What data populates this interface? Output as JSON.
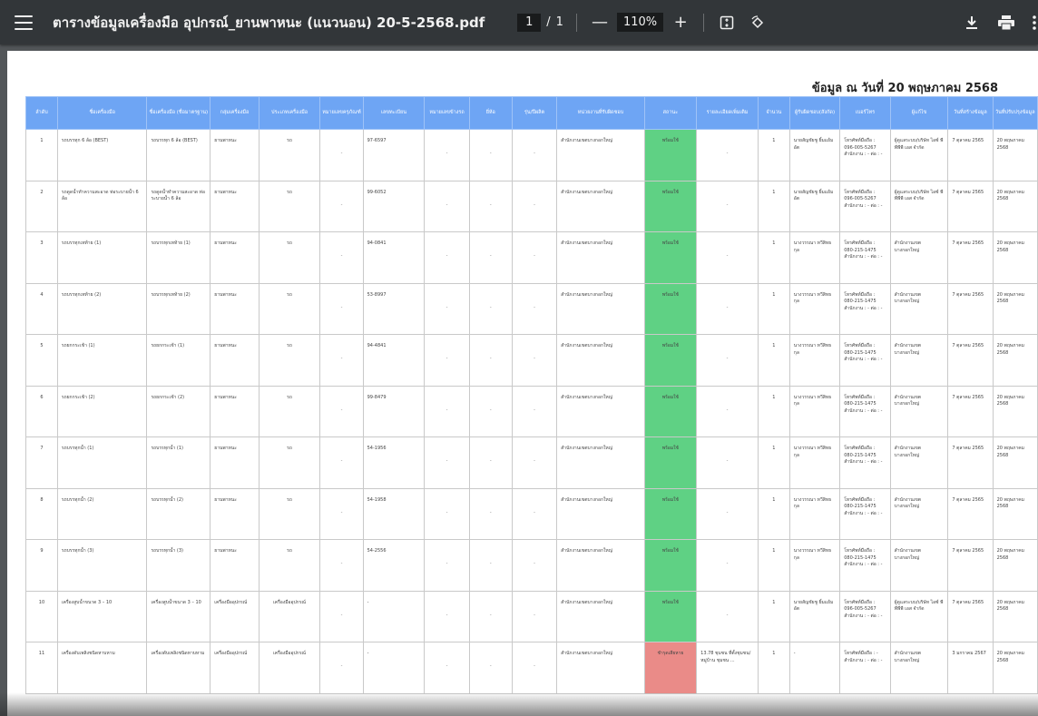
{
  "toolbar": {
    "title": "ตารางข้อมูลเครื่องมือ อุปกรณ์_ยานพาหนะ (แนวนอน) 20-5-2568.pdf",
    "page_current": "1",
    "page_sep": "/",
    "page_total": "1",
    "zoom": "110%",
    "zoom_out": "—",
    "zoom_in": "+"
  },
  "document": {
    "date_heading": "ข้อมูล ณ วันที่ 20 พฤษภาคม 2568",
    "headers": [
      "ลำดับ",
      "ชื่อเครื่องมือ",
      "ชื่อเครื่องมือ (ชื่อมาตรฐาน)",
      "กลุ่มเครื่องมือ",
      "ประเภทเครื่องมือ",
      "หมายเลขครุภัณฑ์",
      "เลขทะเบียน",
      "หมายเลขข้างรถ",
      "ยี่ห้อ",
      "รุ่น/ปีผลิต",
      "หน่วยงานที่รับผิดชอบ",
      "สถานะ",
      "รายละเอียดเพิ่มเติม",
      "จำนวน",
      "ผู้รับผิดชอบ(สังกัด)",
      "เบอร์โทร",
      "ผู้แก้ไข",
      "วันที่สร้างข้อมูล",
      "วันที่ปรับปรุงข้อมูล"
    ],
    "rows": [
      {
        "no": "1",
        "name": "รถบรรทุก 6 ล้อ (BEST)",
        "std_name": "รถบรรทุก 6 ล้อ (BEST)",
        "group": "ยานพาหนะ",
        "type": "รถ",
        "asset": "-",
        "reg": "97-6597",
        "side": "-",
        "brand": "-",
        "model": "-",
        "agency": "สำนักงานเขตบางกอกใหญ่",
        "status": "พร้อมใช้",
        "status_ok": true,
        "detail": "-",
        "qty": "1",
        "owner": "นายสัญชัยชู ยิ้มแย้มอัต",
        "phone": "โทรศัพท์มือถือ : 096-005-5267 สำนักงาน : - ต่อ : -",
        "editor": "ผู้ดูแลระบบ/บริษัท ไอซ์ พีพีพีพี เอส จำกัด",
        "created": "7 ตุลาคม 2565",
        "updated": "20 พฤษภาคม 2568"
      },
      {
        "no": "2",
        "name": "รถดูดน้ำทำความสะอาด ท่อระบายน้ำ 6 ล้อ",
        "std_name": "รถดูดน้ำทำความสะอาด ท่อระบายน้ำ 6 ล้อ",
        "group": "ยานพาหนะ",
        "type": "รถ",
        "asset": "-",
        "reg": "99-6052",
        "side": "-",
        "brand": "-",
        "model": "-",
        "agency": "สำนักงานเขตบางกอกใหญ่",
        "status": "พร้อมใช้",
        "status_ok": true,
        "detail": "-",
        "qty": "1",
        "owner": "นายสัญชัยชู ยิ้มแย้มอัต",
        "phone": "โทรศัพท์มือถือ : 096-005-5267 สำนักงาน : - ต่อ : -",
        "editor": "ผู้ดูแลระบบ/บริษัท ไอซ์ พีพีพีพี เอส จำกัด",
        "created": "7 ตุลาคม 2565",
        "updated": "20 พฤษภาคม 2568"
      },
      {
        "no": "3",
        "name": "รถบรรทุกเทท้าย (1)",
        "std_name": "รถบรรทุกเทท้าย (1)",
        "group": "ยานพาหนะ",
        "type": "รถ",
        "asset": "-",
        "reg": "94-0841",
        "side": "-",
        "brand": "-",
        "model": "-",
        "agency": "สำนักงานเขตบางกอกใหญ่",
        "status": "พร้อมใช้",
        "status_ok": true,
        "detail": "-",
        "qty": "1",
        "owner": "นางวรรณา ทวีสิทธกุล",
        "phone": "โทรศัพท์มือถือ : 080-215-1475 สำนักงาน : - ต่อ : -",
        "editor": "สำนักงานเขตบางกอกใหญ่",
        "created": "7 ตุลาคม 2565",
        "updated": "20 พฤษภาคม 2568"
      },
      {
        "no": "4",
        "name": "รถบรรทุกเทท้าย (2)",
        "std_name": "รถบรรทุกเทท้าย (2)",
        "group": "ยานพาหนะ",
        "type": "รถ",
        "asset": "-",
        "reg": "53-8997",
        "side": "-",
        "brand": "-",
        "model": "-",
        "agency": "สำนักงานเขตบางกอกใหญ่",
        "status": "พร้อมใช้",
        "status_ok": true,
        "detail": "-",
        "qty": "1",
        "owner": "นางวรรณา ทวีสิทธกุล",
        "phone": "โทรศัพท์มือถือ : 080-215-1475 สำนักงาน : - ต่อ : -",
        "editor": "สำนักงานเขตบางกอกใหญ่",
        "created": "7 ตุลาคม 2565",
        "updated": "20 พฤษภาคม 2568"
      },
      {
        "no": "5",
        "name": "รถยกกระเช้า (1)",
        "std_name": "รถยกกระเช้า (1)",
        "group": "ยานพาหนะ",
        "type": "รถ",
        "asset": "-",
        "reg": "94-4841",
        "side": "-",
        "brand": "-",
        "model": "-",
        "agency": "สำนักงานเขตบางกอกใหญ่",
        "status": "พร้อมใช้",
        "status_ok": true,
        "detail": "-",
        "qty": "1",
        "owner": "นางวรรณา ทวีสิทธกุล",
        "phone": "โทรศัพท์มือถือ : 080-215-1475 สำนักงาน : - ต่อ : -",
        "editor": "สำนักงานเขตบางกอกใหญ่",
        "created": "7 ตุลาคม 2565",
        "updated": "20 พฤษภาคม 2568"
      },
      {
        "no": "6",
        "name": "รถยกกระเช้า (2)",
        "std_name": "รถยกกระเช้า (2)",
        "group": "ยานพาหนะ",
        "type": "รถ",
        "asset": "-",
        "reg": "99-8479",
        "side": "-",
        "brand": "-",
        "model": "-",
        "agency": "สำนักงานเขตบางกอกใหญ่",
        "status": "พร้อมใช้",
        "status_ok": true,
        "detail": "-",
        "qty": "1",
        "owner": "นางวรรณา ทวีสิทธกุล",
        "phone": "โทรศัพท์มือถือ : 080-215-1475 สำนักงาน : - ต่อ : -",
        "editor": "สำนักงานเขตบางกอกใหญ่",
        "created": "7 ตุลาคม 2565",
        "updated": "20 พฤษภาคม 2568"
      },
      {
        "no": "7",
        "name": "รถบรรทุกน้ำ (1)",
        "std_name": "รถบรรทุกน้ำ (1)",
        "group": "ยานพาหนะ",
        "type": "รถ",
        "asset": "-",
        "reg": "54-1956",
        "side": "-",
        "brand": "-",
        "model": "-",
        "agency": "สำนักงานเขตบางกอกใหญ่",
        "status": "พร้อมใช้",
        "status_ok": true,
        "detail": "-",
        "qty": "1",
        "owner": "นางวรรณา ทวีสิทธกุล",
        "phone": "โทรศัพท์มือถือ : 080-215-1475 สำนักงาน : - ต่อ : -",
        "editor": "สำนักงานเขตบางกอกใหญ่",
        "created": "7 ตุลาคม 2565",
        "updated": "20 พฤษภาคม 2568"
      },
      {
        "no": "8",
        "name": "รถบรรทุกน้ำ (2)",
        "std_name": "รถบรรทุกน้ำ (2)",
        "group": "ยานพาหนะ",
        "type": "รถ",
        "asset": "-",
        "reg": "54-1958",
        "side": "-",
        "brand": "-",
        "model": "-",
        "agency": "สำนักงานเขตบางกอกใหญ่",
        "status": "พร้อมใช้",
        "status_ok": true,
        "detail": "-",
        "qty": "1",
        "owner": "นางวรรณา ทวีสิทธกุล",
        "phone": "โทรศัพท์มือถือ : 080-215-1475 สำนักงาน : - ต่อ : -",
        "editor": "สำนักงานเขตบางกอกใหญ่",
        "created": "7 ตุลาคม 2565",
        "updated": "20 พฤษภาคม 2568"
      },
      {
        "no": "9",
        "name": "รถบรรทุกน้ำ (3)",
        "std_name": "รถบรรทุกน้ำ (3)",
        "group": "ยานพาหนะ",
        "type": "รถ",
        "asset": "-",
        "reg": "54-2556",
        "side": "-",
        "brand": "-",
        "model": "-",
        "agency": "สำนักงานเขตบางกอกใหญ่",
        "status": "พร้อมใช้",
        "status_ok": true,
        "detail": "-",
        "qty": "1",
        "owner": "นางวรรณา ทวีสิทธกุล",
        "phone": "โทรศัพท์มือถือ : 080-215-1475 สำนักงาน : - ต่อ : -",
        "editor": "สำนักงานเขตบางกอกใหญ่",
        "created": "7 ตุลาคม 2565",
        "updated": "20 พฤษภาคม 2568"
      },
      {
        "no": "10",
        "name": "เครื่องสูบน้ำขนาด 3 – 10",
        "std_name": "เครื่องสูบน้ำขนาด 3 – 10",
        "group": "เครื่องมืออุปกรณ์",
        "type": "เครื่องมืออุปกรณ์",
        "asset": "-",
        "reg": "-",
        "side": "-",
        "brand": "-",
        "model": "-",
        "agency": "สำนักงานเขตบางกอกใหญ่",
        "status": "พร้อมใช้",
        "status_ok": true,
        "detail": "-",
        "qty": "1",
        "owner": "นายสัญชัยชู ยิ้มแย้มอัต",
        "phone": "โทรศัพท์มือถือ : 096-005-5267 สำนักงาน : - ต่อ : -",
        "editor": "ผู้ดูแลระบบ/บริษัท ไอซ์ พีพีพีพี เอส จำกัด",
        "created": "7 ตุลาคม 2565",
        "updated": "20 พฤษภาคม 2568"
      },
      {
        "no": "11",
        "name": "เครื่องดับเพลิงชนิดหาบหาม",
        "std_name": "เครื่องดับเพลิงชนิดหาบหาม",
        "group": "เครื่องมืออุปกรณ์",
        "type": "เครื่องมืออุปกรณ์",
        "asset": "-",
        "reg": "-",
        "side": "-",
        "brand": "-",
        "model": "-",
        "agency": "สำนักงานเขตบางกอกใหญ่",
        "status": "ชำรุดเสียหาย",
        "status_ok": false,
        "detail": "13.78 ชุมชน ที่ตั้งชุมชน/หมู่บ้าน ชุมชน ...",
        "qty": "1",
        "owner": "-",
        "phone": "โทรศัพท์มือถือ : - สำนักงาน : - ต่อ : -",
        "editor": "สำนักงานเขตบางกอกใหญ่",
        "created": "3 มกราคม 2567",
        "updated": "20 พฤษภาคม 2568"
      }
    ]
  },
  "colors": {
    "toolbar": "#323639",
    "header": "#6ea5f4",
    "ok": "#5fd184",
    "bad": "#ea8b88"
  },
  "icons": [
    "menu-icon",
    "fit-page-icon",
    "rotate-icon",
    "download-icon",
    "print-icon",
    "more-icon"
  ]
}
